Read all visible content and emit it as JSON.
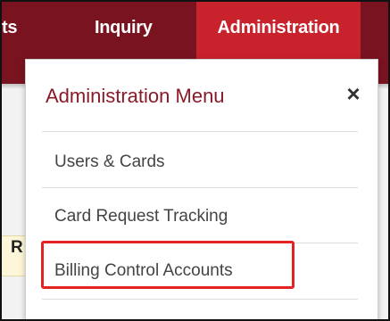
{
  "nav": {
    "partial_label": "ts",
    "inquiry_label": "Inquiry",
    "admin_label": "Administration"
  },
  "page": {
    "partial_letter": "R"
  },
  "menu": {
    "title": "Administration Menu",
    "close_glyph": "×",
    "items": [
      {
        "label": "Users & Cards"
      },
      {
        "label": "Card Request Tracking"
      },
      {
        "label": "Billing Control Accounts"
      }
    ]
  },
  "colors": {
    "nav_background": "#7a1320",
    "nav_active": "#c8222d",
    "menu_title": "#8a1a28",
    "highlight": "#e32222"
  },
  "icons": {
    "close": "close-icon"
  }
}
